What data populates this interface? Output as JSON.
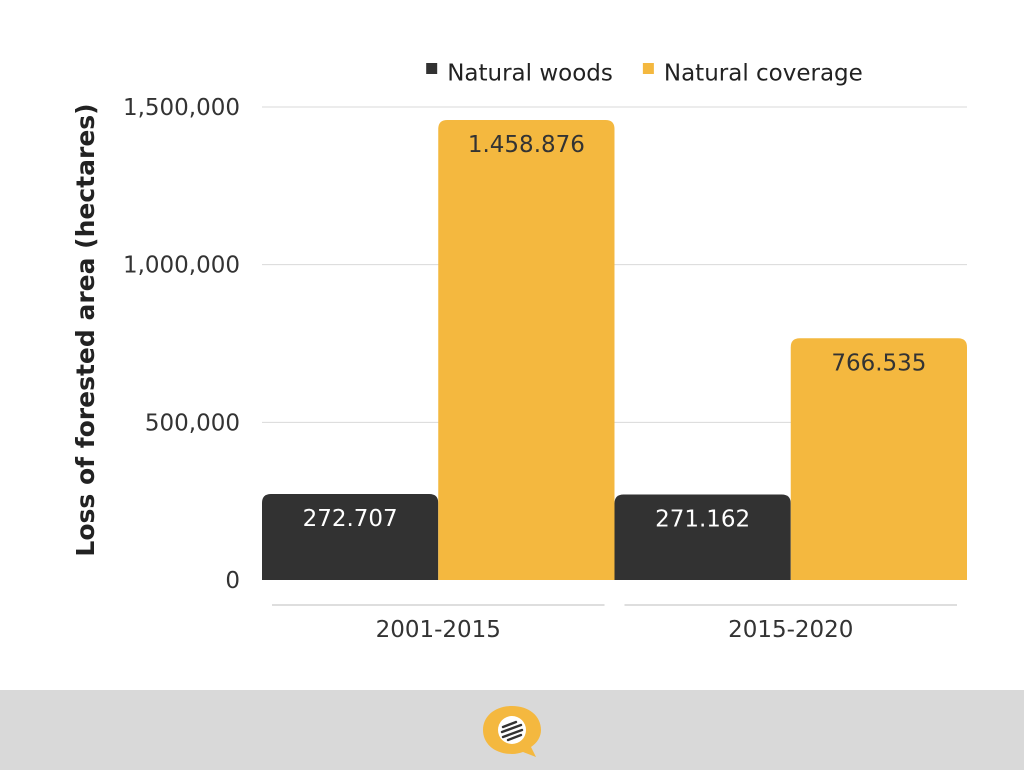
{
  "chart_data": {
    "type": "bar",
    "categories": [
      "2001-2015",
      "2015-2020"
    ],
    "series": [
      {
        "name": "Natural woods",
        "values": [
          272707,
          271162
        ],
        "labels": [
          "272.707",
          "271.162"
        ],
        "color": "#323232"
      },
      {
        "name": "Natural coverage",
        "values": [
          1458876,
          766535
        ],
        "labels": [
          "1.458.876",
          "766.535"
        ],
        "color": "#f4b83f"
      }
    ],
    "ylabel": "Loss of forested area (hectares)",
    "ylim": [
      0,
      1500000
    ],
    "yticks": [
      0,
      500000,
      1000000,
      1500000
    ],
    "ytick_labels": [
      "0",
      "500,000",
      "1,000,000",
      "1,500,000"
    ],
    "grid": true,
    "legend": "top"
  },
  "footer": {
    "logo_icon": "speech-bubble-logo-icon",
    "accent": "#f4b83f",
    "background": "#d9d9d9"
  }
}
